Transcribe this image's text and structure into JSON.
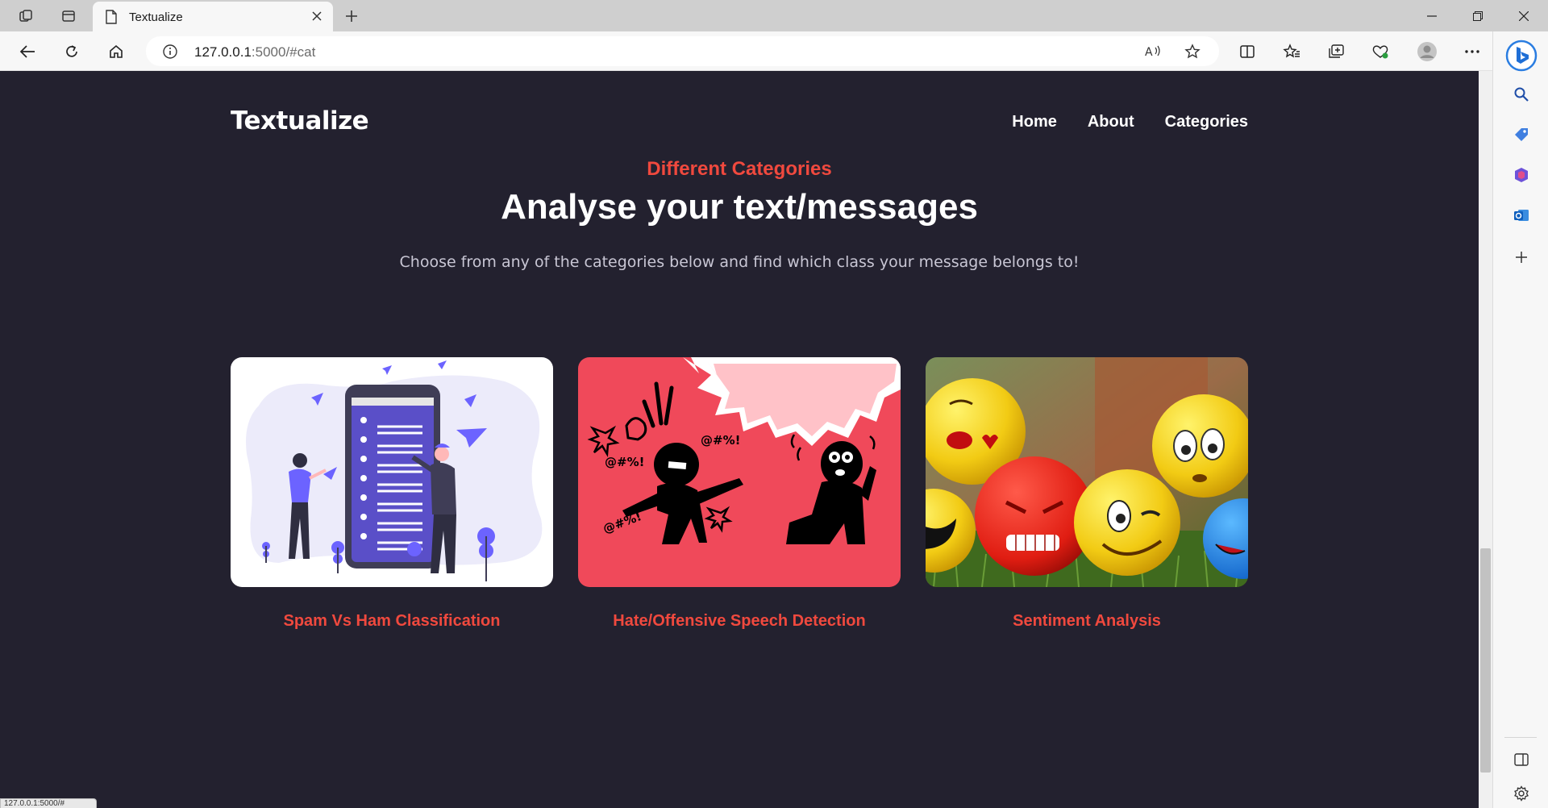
{
  "browser": {
    "tab_title": "Textualize",
    "address_host": "127.0.0.1",
    "address_rest": ":5000/#cat",
    "status_url": "127.0.0.1:5000/#"
  },
  "page": {
    "brand": "Textualize",
    "nav": [
      "Home",
      "About",
      "Categories"
    ],
    "eyebrow": "Different Categories",
    "headline": "Analyse your text/messages",
    "subtext": "Choose from any of the categories below and find which class your message belongs to!",
    "cards": [
      {
        "label": "Spam Vs Ham Classification",
        "image": "spam-illustration"
      },
      {
        "label": "Hate/Offensive Speech Detection",
        "image": "hate-speech-illustration"
      },
      {
        "label": "Sentiment Analysis",
        "image": "emoji-balls-photo"
      }
    ],
    "hate_symbols": [
      "@#%!",
      "@#%!",
      "@#%!"
    ]
  },
  "colors": {
    "page_bg": "#23212f",
    "accent": "#f0493e",
    "card_red": "#f0495a",
    "purple": "#5a4fc8"
  }
}
